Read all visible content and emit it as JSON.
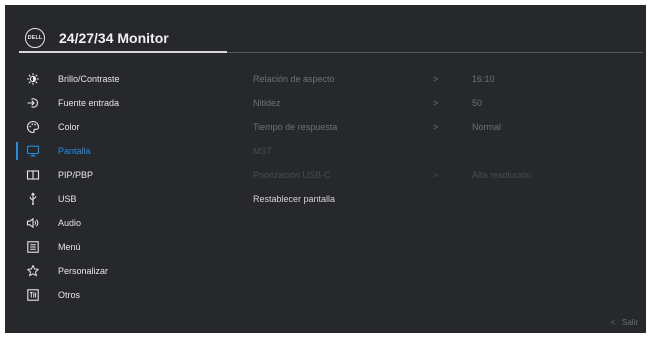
{
  "header": {
    "logo_text": "DELL",
    "title": "24/27/34 Monitor"
  },
  "colors": {
    "background": "#26282b",
    "accent": "#1d8fe6",
    "text": "#e6e6e6",
    "dim_text": "#6d7075",
    "disabled_text": "#4a4d52"
  },
  "menu": {
    "selected": "Pantalla",
    "items": [
      {
        "label": "Brillo/Contraste",
        "icon": "brightness-icon"
      },
      {
        "label": "Fuente entrada",
        "icon": "input-source-icon"
      },
      {
        "label": "Color",
        "icon": "color-palette-icon"
      },
      {
        "label": "Pantalla",
        "icon": "display-icon"
      },
      {
        "label": "PIP/PBP",
        "icon": "pip-pbp-icon"
      },
      {
        "label": "USB",
        "icon": "usb-icon"
      },
      {
        "label": "Audio",
        "icon": "speaker-icon"
      },
      {
        "label": "Menú",
        "icon": "menu-icon"
      },
      {
        "label": "Personalizar",
        "icon": "star-icon"
      },
      {
        "label": "Otros",
        "icon": "others-icon"
      }
    ]
  },
  "submenu": {
    "items": [
      {
        "label": "Relación de aspecto",
        "chevron": ">",
        "value": "16:10",
        "state": "normal"
      },
      {
        "label": "Nitidez",
        "chevron": ">",
        "value": "50",
        "state": "normal"
      },
      {
        "label": "Tiempo de respuesta",
        "chevron": ">",
        "value": "Normal",
        "state": "normal"
      },
      {
        "label": "MST",
        "chevron": "",
        "value": "",
        "state": "disabled"
      },
      {
        "label": "Priorización USB-C",
        "chevron": ">",
        "value": "Alta resolución",
        "state": "disabled"
      },
      {
        "label": "Restablecer pantalla",
        "chevron": "",
        "value": "",
        "state": "enabled"
      }
    ]
  },
  "footer": {
    "exit_chevron": "<",
    "exit_label": "Salir"
  }
}
